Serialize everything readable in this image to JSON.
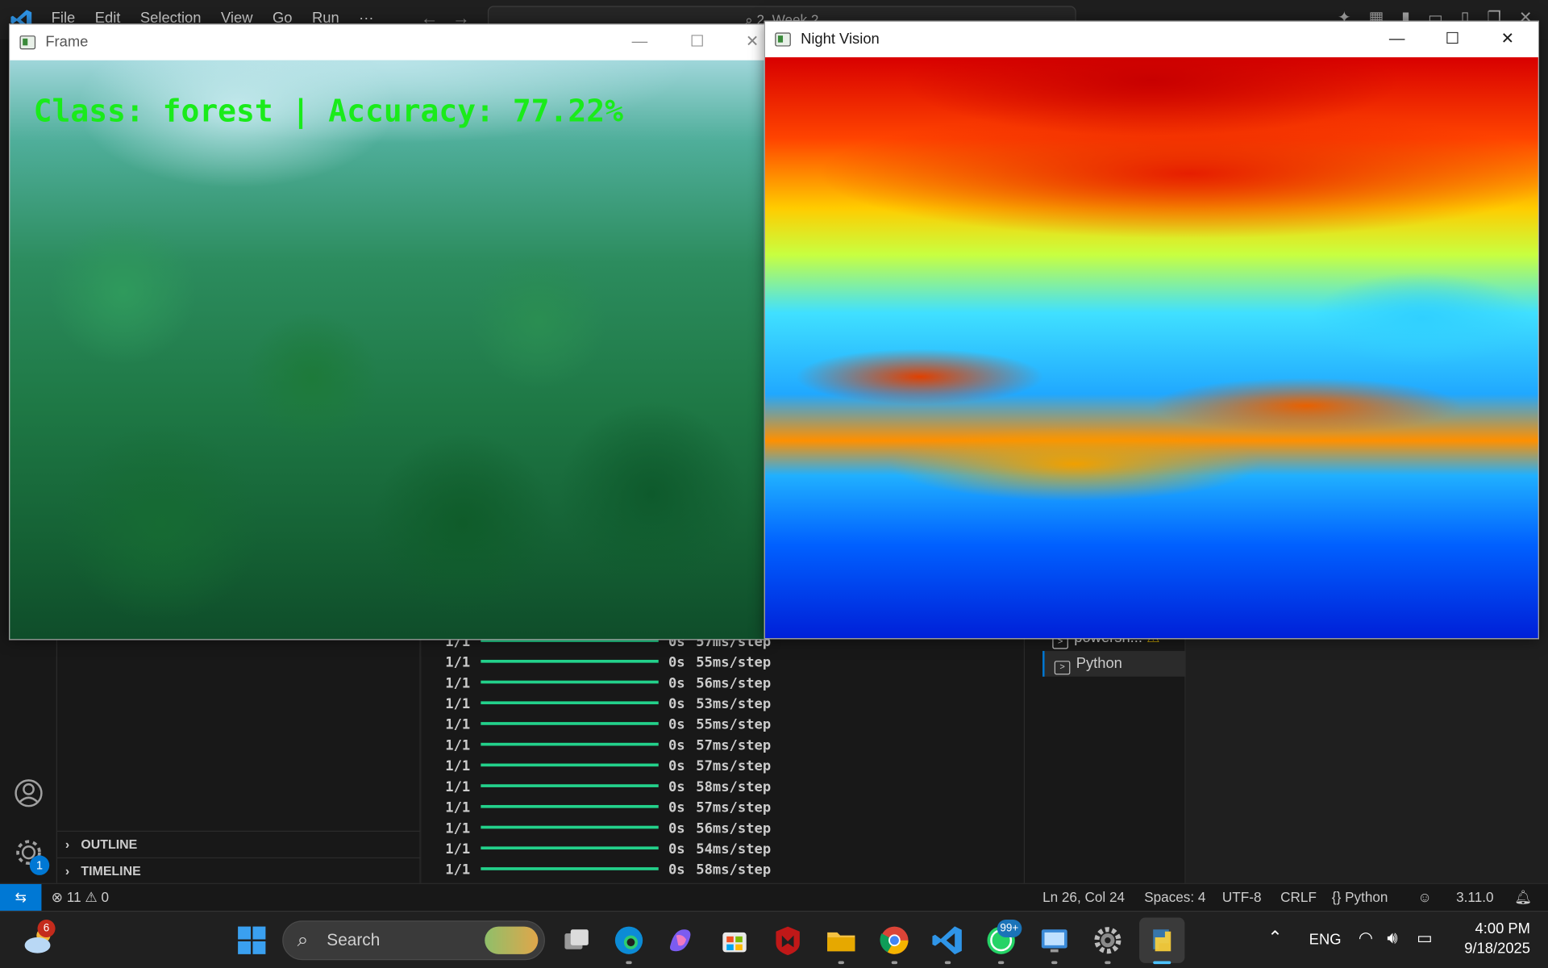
{
  "vscode": {
    "menu": [
      "File",
      "Edit",
      "Selection",
      "View",
      "Go",
      "Run",
      "···"
    ],
    "command_center": "2. Week 2",
    "sidebar_sections": [
      {
        "label": "OUTLINE"
      },
      {
        "label": "TIMELINE"
      }
    ],
    "terminal_lines": [
      {
        "frac": "1/1",
        "time": "0s",
        "step": "57ms/step"
      },
      {
        "frac": "1/1",
        "time": "0s",
        "step": "55ms/step"
      },
      {
        "frac": "1/1",
        "time": "0s",
        "step": "56ms/step"
      },
      {
        "frac": "1/1",
        "time": "0s",
        "step": "53ms/step"
      },
      {
        "frac": "1/1",
        "time": "0s",
        "step": "55ms/step"
      },
      {
        "frac": "1/1",
        "time": "0s",
        "step": "57ms/step"
      },
      {
        "frac": "1/1",
        "time": "0s",
        "step": "57ms/step"
      },
      {
        "frac": "1/1",
        "time": "0s",
        "step": "58ms/step"
      },
      {
        "frac": "1/1",
        "time": "0s",
        "step": "57ms/step"
      },
      {
        "frac": "1/1",
        "time": "0s",
        "step": "56ms/step"
      },
      {
        "frac": "1/1",
        "time": "0s",
        "step": "54ms/step"
      },
      {
        "frac": "1/1",
        "time": "0s",
        "step": "58ms/step"
      }
    ],
    "terminal_tabs": [
      {
        "label": "powersh...",
        "warning": "⚠"
      },
      {
        "label": "Python"
      }
    ],
    "account_badge": "1",
    "status": {
      "errors": "11",
      "warnings": "0",
      "position": "Ln 26, Col 24",
      "spaces": "Spaces: 4",
      "encoding": "UTF-8",
      "eol": "CRLF",
      "language": "Python",
      "python_version": "3.11.0"
    }
  },
  "windows": {
    "frame": {
      "title": "Frame",
      "overlay": "Class: forest | Accuracy: 77.22%"
    },
    "night_vision": {
      "title": "Night Vision"
    }
  },
  "taskbar": {
    "weather_badge": "6",
    "search_label": "Search",
    "whatsapp_badge": "99+",
    "language": "ENG",
    "time": "4:00 PM",
    "date": "9/18/2025"
  },
  "colors": {
    "accent": "#0078d4",
    "overlay_text": "#1aeb1a",
    "progress_bar": "#23d18b"
  }
}
